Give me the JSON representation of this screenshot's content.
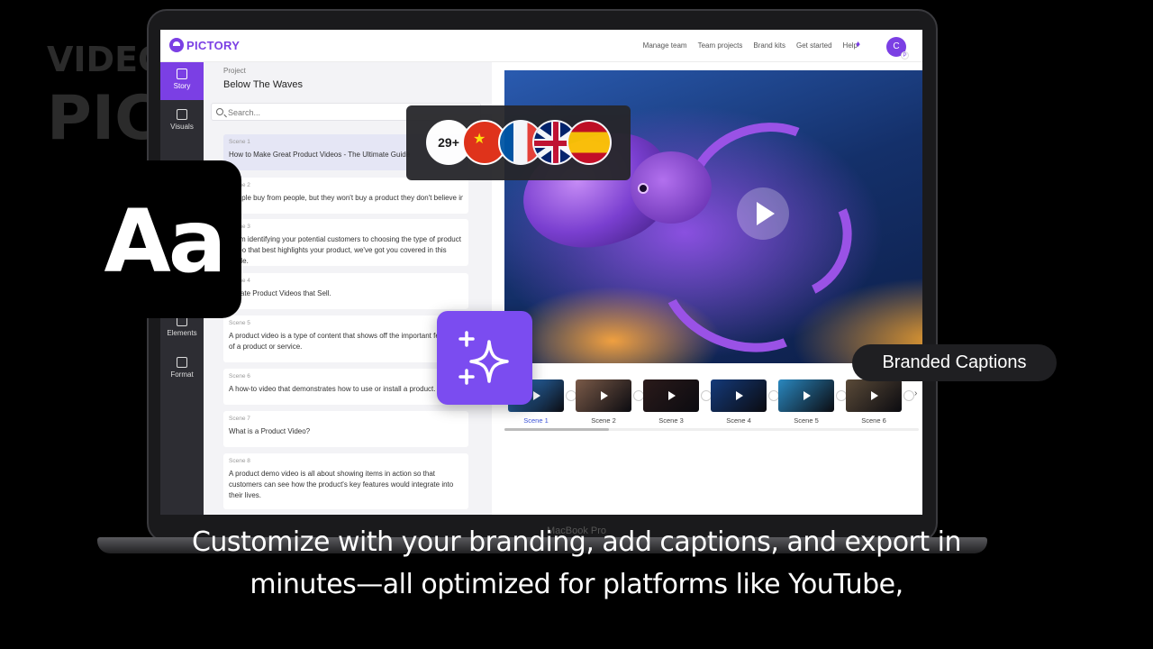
{
  "background_text": {
    "line1": "VIDEOS MADE WITH",
    "line2": "PICTORY"
  },
  "device_label": "MacBook Pro",
  "app": {
    "logo_text": "PICTORY",
    "nav": [
      "Manage team",
      "Team projects",
      "Brand kits",
      "Get started",
      "Help"
    ],
    "user_initial": "C",
    "user_sub_initial": "P"
  },
  "rail": [
    "Story",
    "Visuals",
    "Elements",
    "Format"
  ],
  "story": {
    "project_label": "Project",
    "project_title": "Below The Waves",
    "search_placeholder": "Search...",
    "scenes": [
      {
        "label": "Scene 1",
        "text": "How to Make Great Product Videos - The Ultimate Guide"
      },
      {
        "label": "Scene 2",
        "text": "People buy from people, but they won't buy a product they don't believe in."
      },
      {
        "label": "Scene 3",
        "text": "From identifying your potential customers to choosing the type of product video that best highlights your product, we've got you covered in this guide."
      },
      {
        "label": "Scene 4",
        "text": "Create Product Videos that Sell."
      },
      {
        "label": "Scene 5",
        "text": "A product video is a type of content that shows off the important features of a product or service."
      },
      {
        "label": "Scene 6",
        "text": "A how-to video that demonstrates how to use or install a product."
      },
      {
        "label": "Scene 7",
        "text": "What is a Product Video?"
      },
      {
        "label": "Scene 8",
        "text": "A product demo video is all about showing items in action so that customers can see how the product's key features would integrate into their lives."
      }
    ]
  },
  "strip": {
    "scenes": [
      "Scene 1",
      "Scene 2",
      "Scene 3",
      "Scene 4",
      "Scene 5",
      "Scene 6"
    ],
    "active": "Scene 1",
    "thumb_colors": [
      "#2f7fd0",
      "#7a5a48",
      "#2a1a1a",
      "#143a7a",
      "#2a88c0",
      "#5a4a38"
    ]
  },
  "languages": {
    "count": "29+",
    "flags": [
      "china-flag-icon",
      "france-flag-icon",
      "uk-flag-icon",
      "spain-flag-icon"
    ]
  },
  "feature_tiles": {
    "font_glyph": "Aa",
    "ai_icon": "sparkle-icon"
  },
  "badge": "Branded Captions",
  "subtitles": {
    "line1": "Customize with your branding, add captions, and export in",
    "line2": "minutes—all optimized for platforms like YouTube,"
  },
  "colors": {
    "brand": "#7b3fe4",
    "rail": "#2d2d33",
    "ai_tile": "#7b4cf0"
  }
}
